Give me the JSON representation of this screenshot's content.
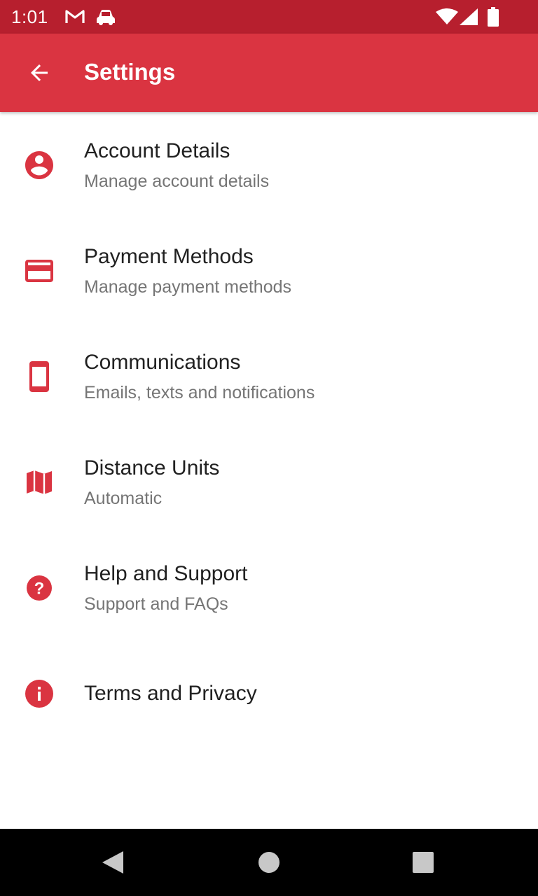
{
  "status_bar": {
    "time": "1:01",
    "left_icons": [
      "gmail-icon",
      "car-icon"
    ],
    "right_icons": [
      "wifi-icon",
      "signal-icon",
      "battery-icon"
    ]
  },
  "app_bar": {
    "title": "Settings",
    "back_icon": "arrow-back-icon"
  },
  "colors": {
    "accent": "#da3441",
    "status_bar": "#b71f2e",
    "title_text": "#212121",
    "subtitle_text": "#757575"
  },
  "settings": {
    "items": [
      {
        "icon": "account-circle-icon",
        "title": "Account Details",
        "subtitle": "Manage account details"
      },
      {
        "icon": "credit-card-icon",
        "title": "Payment Methods",
        "subtitle": "Manage payment methods"
      },
      {
        "icon": "smartphone-icon",
        "title": "Communications",
        "subtitle": "Emails, texts and notifications"
      },
      {
        "icon": "map-icon",
        "title": "Distance Units",
        "subtitle": "Automatic"
      },
      {
        "icon": "help-icon",
        "title": "Help and Support",
        "subtitle": "Support and FAQs"
      },
      {
        "icon": "info-icon",
        "title": "Terms and Privacy",
        "subtitle": ""
      }
    ]
  },
  "nav_bar": {
    "buttons": [
      "back-triangle-icon",
      "home-circle-icon",
      "recents-square-icon"
    ]
  }
}
